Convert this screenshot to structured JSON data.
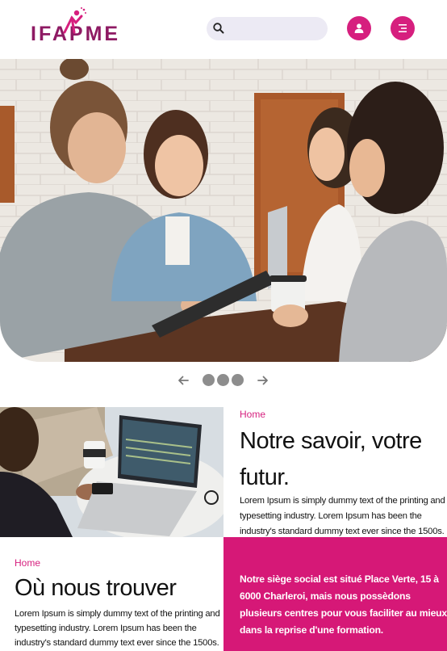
{
  "header": {
    "logo_text": "IFAPME",
    "search": {
      "placeholder": "",
      "value": ""
    },
    "user_button_icon": "user-icon",
    "menu_button_icon": "menu-icon"
  },
  "colors": {
    "brand_pink": "#d61f7e",
    "brand_purple": "#8e1a63",
    "dot_gray": "#8d8d8d"
  },
  "carousel": {
    "prev_icon": "arrow-left-icon",
    "next_icon": "arrow-right-icon",
    "dot_count": 3
  },
  "section_savoir": {
    "breadcrumb": "Home",
    "title_line1": "Notre savoir, votre",
    "title_line2": "futur.",
    "body_line1": "Lorem Ipsum is simply dummy text of the printing and",
    "body_line2": "typesetting industry. Lorem Ipsum has been the",
    "body_line3": "industry's standard dummy text ever since the 1500s."
  },
  "section_trouver": {
    "breadcrumb": "Home",
    "title": "Où nous trouver",
    "body_line1": "Lorem Ipsum is simply dummy text of the printing and",
    "body_line2": "typesetting industry. Lorem Ipsum has been the",
    "body_line3": "industry's standard dummy text ever since the 1500s.",
    "address_line1": "Notre siège social est situé Place Verte, 15 à",
    "address_line2": "6000 Charleroi, mais nous possèdons",
    "address_line3": "plusieurs centres pour vous faciliter au mieux",
    "address_line4": "dans la reprise d'une formation."
  }
}
